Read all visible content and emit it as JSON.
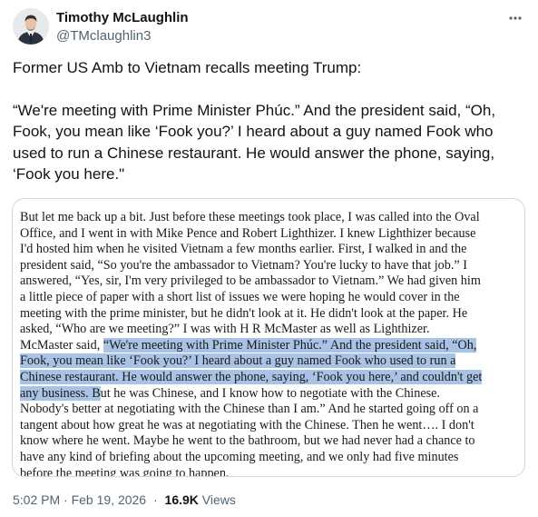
{
  "author": {
    "display_name": "Timothy McLaughlin",
    "handle": "@TMclaughlin3",
    "avatar_icon": "avatar"
  },
  "more_icon": "more-horizontal-icon",
  "tweet": {
    "lines": [
      "Former US Amb to Vietnam recalls meeting Trump:",
      "",
      "“We're meeting with Prime Minister Phúc.” And the president said, “Oh,",
      "Fook, you mean like ‘Fook you?’ I heard about a guy named Fook who",
      "used to run a Chinese restaurant. He would answer the phone, saying,",
      "‘Fook you here.\""
    ]
  },
  "document": {
    "lines": [
      [
        {
          "t": "But let me back up a bit. Just before these meetings took place, I was called into the Oval",
          "h": false
        }
      ],
      [
        {
          "t": "Office, and I went in with Mike Pence and Robert Lighthizer. I knew Lighthizer because",
          "h": false
        }
      ],
      [
        {
          "t": "I'd hosted him when he visited Vietnam a few months earlier. First, I walked in and the",
          "h": false
        }
      ],
      [
        {
          "t": "president said, “So you're the ambassador to Vietnam? You're lucky to have that job.” I",
          "h": false
        }
      ],
      [
        {
          "t": "answered, “Yes, sir, I'm very privileged to be ambassador to Vietnam.” We had given him",
          "h": false
        }
      ],
      [
        {
          "t": "a little piece of paper with a short list of issues we were hoping he would cover in the",
          "h": false
        }
      ],
      [
        {
          "t": "meeting with the prime minister, but he didn't look at it. He didn't look at the paper. He",
          "h": false
        }
      ],
      [
        {
          "t": "asked, “Who are we meeting?” I was with H R McMaster as well as Lighthizer.",
          "h": false
        }
      ],
      [
        {
          "t": "McMaster said, ",
          "h": false
        },
        {
          "t": "“We're meeting with Prime Minister Phúc.” And the president said, “Oh,",
          "h": true
        }
      ],
      [
        {
          "t": "Fook, you mean like ‘Fook you?’ I heard about a guy named Fook who used to run a",
          "h": true
        }
      ],
      [
        {
          "t": "Chinese restaurant. He would answer the phone, saying, ‘Fook you here,’ and couldn't get",
          "h": true
        }
      ],
      [
        {
          "t": "any business. B",
          "h": true
        },
        {
          "t": "ut he was Chinese, and I know how to negotiate with the Chinese.",
          "h": false
        }
      ],
      [
        {
          "t": "Nobody's better at negotiating with the Chinese than I am.” And he started going off on a",
          "h": false
        }
      ],
      [
        {
          "t": "tangent about how great he was at negotiating with the Chinese. Then he went…. I don't",
          "h": false
        }
      ],
      [
        {
          "t": "know where he went. Maybe he went to the bathroom, but we had never had a chance to",
          "h": false
        }
      ],
      [
        {
          "t": "have any kind of briefing about the upcoming meeting, and we only had five minutes",
          "h": false
        }
      ],
      [
        {
          "t": "before the meeting was going to happen.",
          "h": false
        }
      ]
    ]
  },
  "meta": {
    "timestamp": "5:02 PM · Feb 19, 2026",
    "separator": "·",
    "views_count": "16.9K",
    "views_label": "Views"
  }
}
